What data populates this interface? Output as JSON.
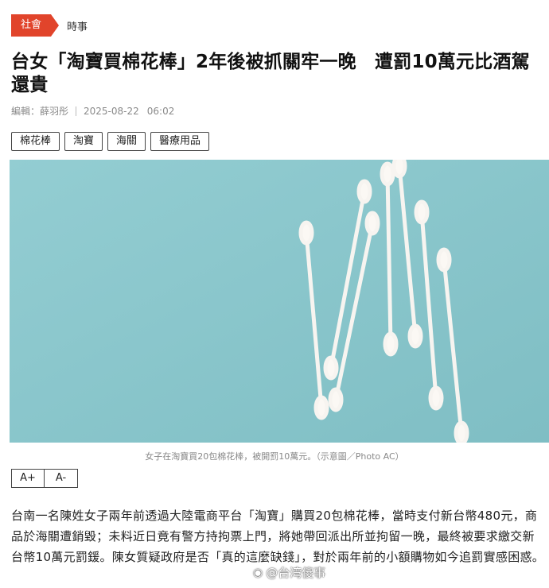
{
  "breadcrumb": {
    "category": "社會",
    "subcategory": "時事"
  },
  "headline": "台女「淘寶買棉花棒」2年後被抓關牢一晚　遭罰10萬元比酒駕還貴",
  "meta": {
    "author": "編輯：薛羽彤",
    "date": "2025-08-22",
    "time": "06:02"
  },
  "tags": [
    "棉花棒",
    "淘寶",
    "海關",
    "醫療用品"
  ],
  "photo": {
    "caption": "女子在淘寶買20包棉花棒，被開罰10萬元。（示意圖／Photo AC）"
  },
  "font_controls": {
    "increase": "A+",
    "decrease": "A-"
  },
  "article": {
    "paragraph": "台南一名陳姓女子兩年前透過大陸電商平台「淘寶」購買20包棉花棒，當時支付新台幣480元，商品於海關遭銷毀；未料近日竟有警方持拘票上門，將她帶回派出所並拘留一晚，最終被要求繳交新台幣10萬元罰鍰。陳女質疑政府是否「真的這麼缺錢」，對於兩年前的小額購物如今追罰實感困惑。"
  },
  "watermark": {
    "text": "@台湾傻事",
    "icon": "weibo-icon"
  },
  "colors": {
    "accent": "#e1442b",
    "photo_background": "#8cc7cd"
  }
}
